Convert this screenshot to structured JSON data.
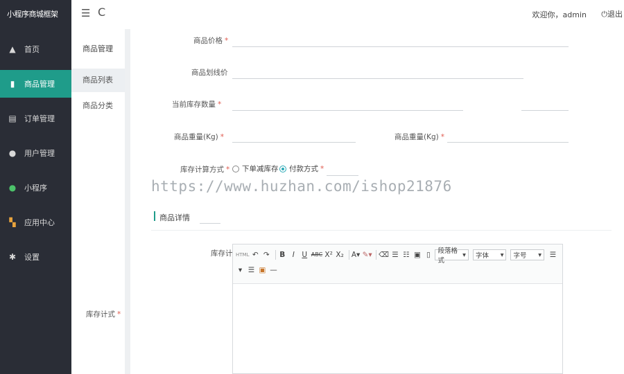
{
  "app": {
    "title": "小程序商城框架"
  },
  "topbar": {
    "menu_icon": "☰",
    "refresh_icon": "C",
    "welcome": "欢迎你，admin",
    "logout_icon": "⏻",
    "logout": "退出"
  },
  "sidebar": {
    "items": [
      {
        "label": "首页",
        "icon": "home-icon"
      },
      {
        "label": "商品管理",
        "icon": "gift-icon",
        "active": true
      },
      {
        "label": "订单管理",
        "icon": "clipboard-icon"
      },
      {
        "label": "用户管理",
        "icon": "user-icon"
      },
      {
        "label": "小程序",
        "icon": "mini-program-icon"
      },
      {
        "label": "应用中心",
        "icon": "apps-icon"
      },
      {
        "label": "设置",
        "icon": "gear-icon"
      }
    ]
  },
  "subnav": {
    "title": "商品管理",
    "items": [
      {
        "label": "商品列表",
        "active": true
      },
      {
        "label": "商品分类"
      }
    ],
    "bottom_label": "库存计式"
  },
  "form": {
    "price": {
      "label": "商品价格"
    },
    "strike_price": {
      "label": "商品划线价"
    },
    "stock": {
      "label": "当前库存数量"
    },
    "weight1": {
      "label": "商品重量(Kg)"
    },
    "weight2": {
      "label": "商品重量(Kg)"
    },
    "stock_method": {
      "label": "库存计算方式",
      "options": [
        "下单减库存",
        "付款方式"
      ],
      "selected": "付款方式"
    }
  },
  "section": {
    "title": "商品详情"
  },
  "editor": {
    "label": "库存计算",
    "toolbar": {
      "code": "HTML",
      "bold": "B",
      "italic": "I",
      "underline": "U",
      "strike": "ABC",
      "sup": "X²",
      "sub": "X₂",
      "fontcolor": "A",
      "paragraph": "段落格式",
      "font": "字体",
      "fontsize": "字号"
    }
  },
  "watermark": "https://www.huzhan.com/ishop21876",
  "colors": {
    "sidebar_bg": "#2a2d36",
    "accent": "#1f9c8a",
    "required": "#e05a4e"
  }
}
